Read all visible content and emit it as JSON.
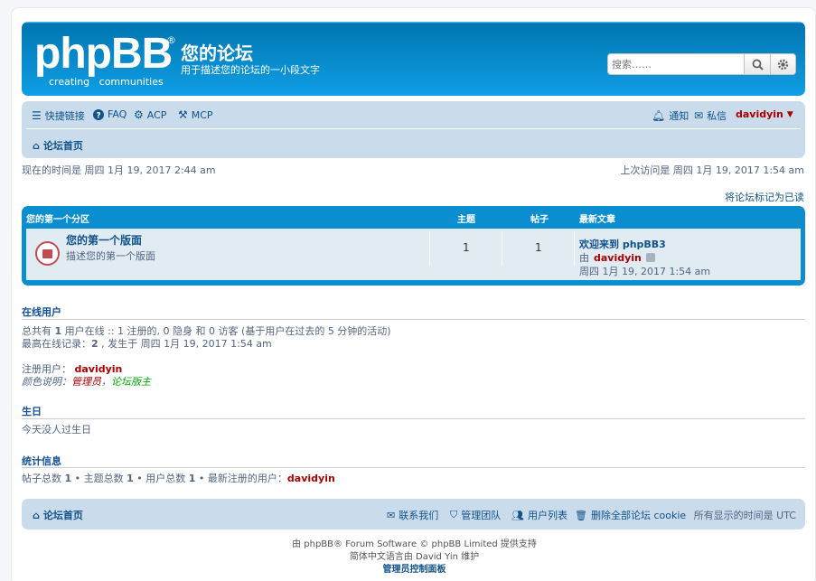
{
  "header": {
    "logo_text": "phpBB",
    "logo_reg": "®",
    "logo_tagline": "creating   communities",
    "site_title": "您的论坛",
    "site_description": "用于描述您的论坛的一小段文字",
    "search_placeholder": "搜索……",
    "search_icon": "search-icon",
    "advanced_icon": "gear-icon"
  },
  "nav": {
    "quick_links": "快捷链接",
    "faq": "FAQ",
    "acp": "ACP",
    "mcp": "MCP",
    "notifications": "通知",
    "pm": "私信",
    "username": "davidyin",
    "breadcrumb_home": "论坛首页"
  },
  "times": {
    "current": "现在的时间是 周四 1月 19, 2017 2:44 am",
    "last_visit": "上次访问是 周四 1月 19, 2017 1:54 am",
    "mark_read": "将论坛标记为已读"
  },
  "forum_table": {
    "category": "您的第一个分区",
    "col_topics": "主题",
    "col_posts": "帖子",
    "col_last_post": "最新文章",
    "forum_name": "您的第一个版面",
    "forum_desc": "描述您的第一个版面",
    "topics": "1",
    "posts": "1",
    "last_post_title": "欢迎来到 phpBB3",
    "last_post_by": "由",
    "last_post_author": "davidyin",
    "last_post_time": "周四 1月 19, 2017 1:54 am"
  },
  "online": {
    "title": "在线用户",
    "line1_pre": "总共有 ",
    "line1_count": "1",
    "line1_post": " 用户在线 :: 1 注册的, 0 隐身 和 0 访客 (基于用户在过去的 5 分钟的活动)",
    "line2_pre": "最高在线记录：",
    "line2_count": "2",
    "line2_post": " , 发生于 周四 1月 19, 2017 1:54 am",
    "registered_label": "注册用户：",
    "registered_user": "davidyin",
    "legend_label": "颜色说明：",
    "legend_admin": "管理员",
    "legend_sep": "，",
    "legend_mod": "论坛版主"
  },
  "birthdays": {
    "title": "生日",
    "text": "今天没人过生日"
  },
  "stats": {
    "title": "统计信息",
    "posts_label": "帖子总数 ",
    "posts": "1",
    "topics_label": " • 主题总数 ",
    "topics": "1",
    "users_label": " • 用户总数 ",
    "users": "1",
    "newest_label": " • 最新注册的用户：",
    "newest": "davidyin"
  },
  "footer": {
    "home": "论坛首页",
    "contact": "联系我们",
    "team": "管理团队",
    "members": "用户列表",
    "delete_cookies": "删除全部论坛 cookie",
    "timezone": "所有显示的时间是 UTC",
    "credit1": "由 phpBB® Forum Software © phpBB Limited 提供支持",
    "credit2": "简体中文语言由 David Yin 维护",
    "acp_link": "管理员控制面板"
  },
  "colors": {
    "header_blue": "#12a3eb",
    "link_blue": "#105289",
    "user_red": "#aa0000",
    "mod_green": "#00aa00"
  }
}
